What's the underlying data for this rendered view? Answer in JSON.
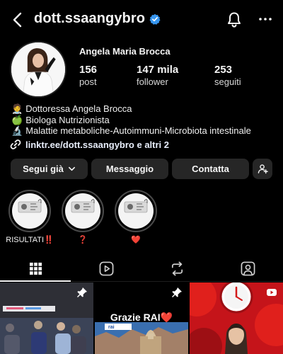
{
  "header": {
    "username": "dott.ssaangybro",
    "back_icon": "chevron-left-icon",
    "verified_icon": "verified-badge-icon",
    "notifications_icon": "bell-icon",
    "more_icon": "more-horizontal-icon"
  },
  "profile": {
    "name": "Angela Maria Brocca",
    "stats": [
      {
        "value": "156",
        "label": "post"
      },
      {
        "value": "147 mila",
        "label": "follower"
      },
      {
        "value": "253",
        "label": "seguiti"
      }
    ],
    "bio": [
      {
        "emoji": "🧑‍⚕️",
        "text": "Dottoressa Angela Brocca"
      },
      {
        "emoji": "🍏",
        "text": "Biologa Nutrizionista"
      },
      {
        "emoji": "🔬",
        "text": "Malattie metaboliche-Autoimmuni-Microbiota intestinale"
      }
    ],
    "link": "linktr.ee/dott.ssaangybro e altri 2",
    "link_icon": "link-icon"
  },
  "actions": {
    "following": "Segui già",
    "message": "Messaggio",
    "contact": "Contatta",
    "add_user_icon": "add-user-icon"
  },
  "highlights": [
    {
      "label": "RISULTATI‼️",
      "cover_text": "NUTRI IL TUO CORPO, NON SAZIARLO"
    },
    {
      "label": "❓",
      "cover_text": "NUTRI IL TUO CORPO, NON SAZIARLO"
    },
    {
      "label": "❤️",
      "cover_text": "NUTRI IL TUO CORPO, NON SAZIARLO"
    }
  ],
  "tabs": [
    {
      "icon": "grid-icon",
      "active": true
    },
    {
      "icon": "reels-icon",
      "active": false
    },
    {
      "icon": "reposts-icon",
      "active": false
    },
    {
      "icon": "tagged-icon",
      "active": false
    }
  ],
  "posts": [
    {
      "caption": "",
      "pinned": true,
      "kind": "photo"
    },
    {
      "caption": "Grazie RAI❤️",
      "pinned": true,
      "kind": "photo"
    },
    {
      "caption": "",
      "pinned": false,
      "kind": "video"
    }
  ],
  "colors": {
    "background": "#000000",
    "button": "#262626",
    "verified": "#3897f0",
    "accent_red": "#e0201c"
  }
}
